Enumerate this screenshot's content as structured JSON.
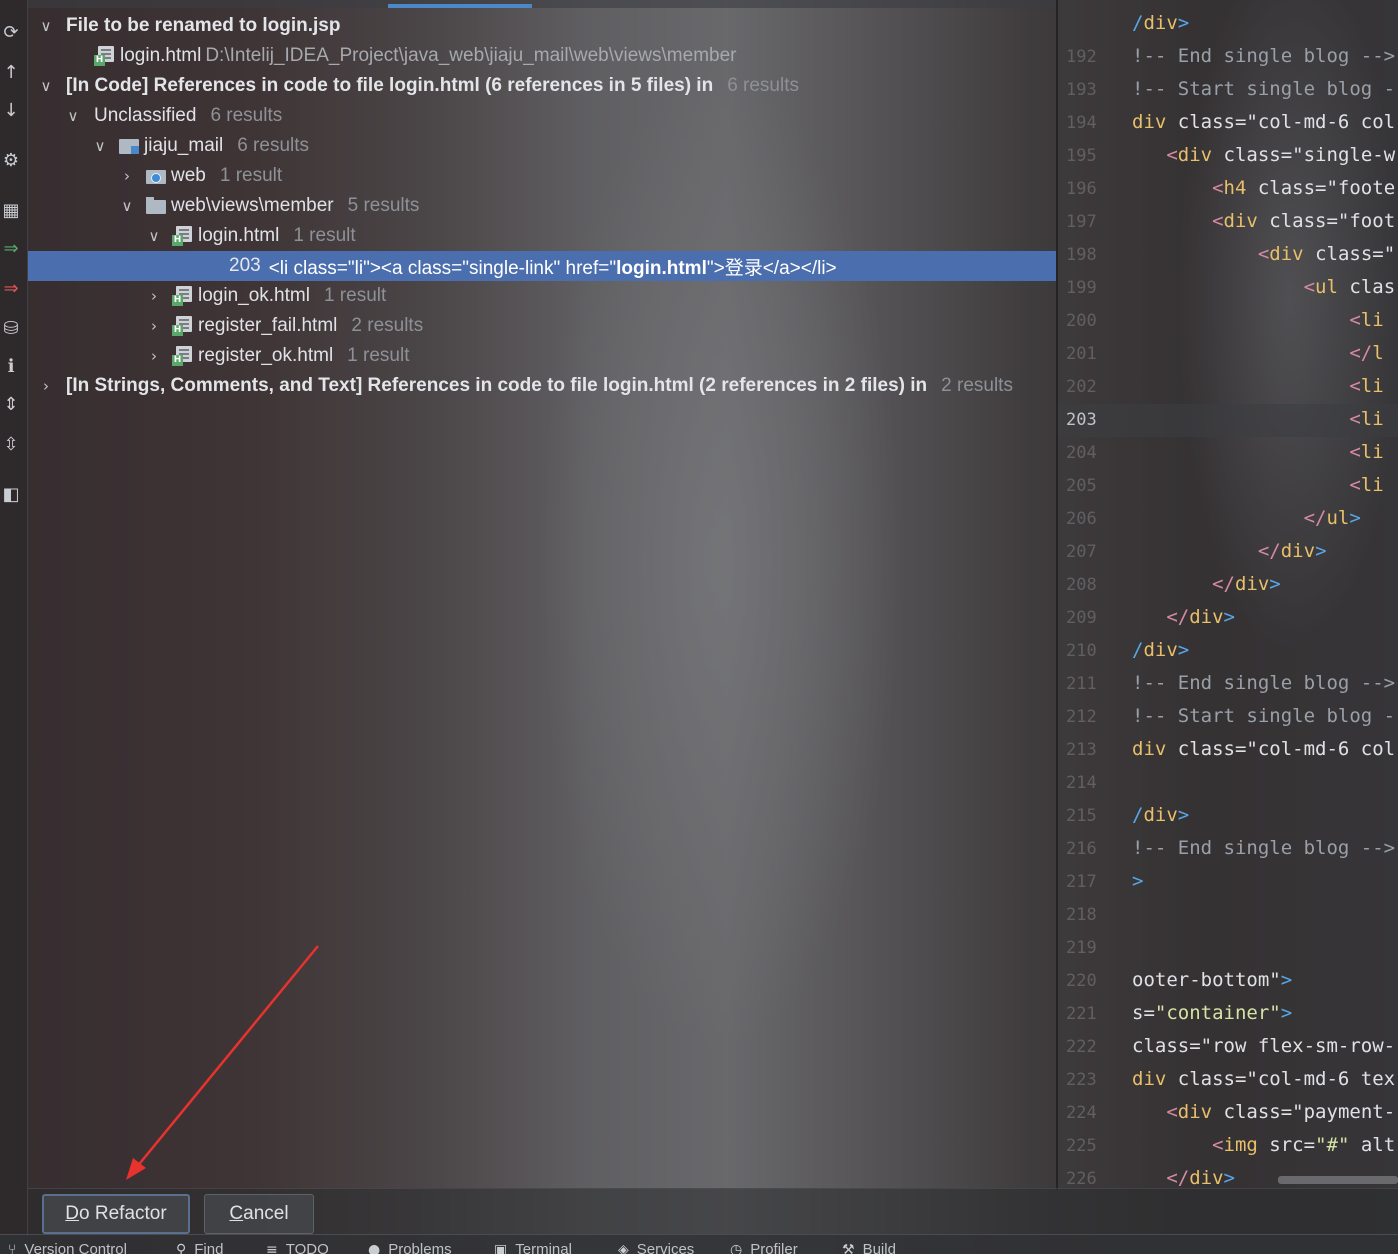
{
  "tree": {
    "rows": [
      {
        "level": 0,
        "expanded": true,
        "bold": true,
        "label": "File to be renamed to login.jsp"
      },
      {
        "level": 1,
        "icon": "html",
        "label": "login.html",
        "path": "D:\\Intelij_IDEA_Project\\java_web\\jiaju_mail\\web\\views\\member"
      },
      {
        "level": 0,
        "expanded": true,
        "bold": true,
        "label": "[In Code] References in code to file login.html (6 references in 5 files) in",
        "count": "6 results"
      },
      {
        "level": 1,
        "expanded": true,
        "label": "Unclassified",
        "count": "6 results"
      },
      {
        "level": 2,
        "expanded": true,
        "icon": "module",
        "label": "jiaju_mail",
        "count": "6 results"
      },
      {
        "level": 3,
        "expanded": false,
        "icon": "web",
        "label": "web",
        "count": "1 result"
      },
      {
        "level": 3,
        "expanded": true,
        "icon": "folder",
        "label": "web\\views\\member",
        "count": "5 results"
      },
      {
        "level": 4,
        "expanded": true,
        "icon": "html",
        "label": "login.html",
        "count": "1 result"
      },
      {
        "level": 5,
        "selected": true,
        "line": "203",
        "code_before": "<li class=\"li\"><a class=\"single-link\" href=\"",
        "code_bold": "login.html",
        "code_after": "\">登录</a></li>"
      },
      {
        "level": 4,
        "expanded": false,
        "icon": "html",
        "label": "login_ok.html",
        "count": "1 result"
      },
      {
        "level": 4,
        "expanded": false,
        "icon": "html",
        "label": "register_fail.html",
        "count": "2 results"
      },
      {
        "level": 4,
        "expanded": false,
        "icon": "html",
        "label": "register_ok.html",
        "count": "1 result"
      },
      {
        "level": 0,
        "expanded": false,
        "bold": true,
        "label": "[In Strings, Comments, and Text] References in code to file login.html (2 references in 2 files) in",
        "count": "2 results"
      }
    ]
  },
  "editor": {
    "current_line": "203",
    "lines": [
      {
        "num": "",
        "text": "/div>"
      },
      {
        "num": "192",
        "text": "!-- End single blog -->"
      },
      {
        "num": "193",
        "text": "!-- Start single blog -->"
      },
      {
        "num": "194",
        "text": "div class=\"col-md-6 col"
      },
      {
        "num": "195",
        "text": "   <div class=\"single-w"
      },
      {
        "num": "196",
        "text": "       <h4 class=\"foote"
      },
      {
        "num": "197",
        "text": "       <div class=\"foot"
      },
      {
        "num": "198",
        "text": "           <div class=\""
      },
      {
        "num": "199",
        "text": "               <ul clas"
      },
      {
        "num": "200",
        "text": "                   <li"
      },
      {
        "num": "201",
        "text": "                   </l"
      },
      {
        "num": "202",
        "text": "                   <li"
      },
      {
        "num": "203",
        "text": "                   <li"
      },
      {
        "num": "204",
        "text": "                   <li"
      },
      {
        "num": "205",
        "text": "                   <li"
      },
      {
        "num": "206",
        "text": "               </ul>"
      },
      {
        "num": "207",
        "text": "           </div>"
      },
      {
        "num": "208",
        "text": "       </div>"
      },
      {
        "num": "209",
        "text": "   </div>"
      },
      {
        "num": "210",
        "text": "/div>"
      },
      {
        "num": "211",
        "text": "!-- End single blog -->"
      },
      {
        "num": "212",
        "text": "!-- Start single blog -->"
      },
      {
        "num": "213",
        "text": "div class=\"col-md-6 col"
      },
      {
        "num": "214",
        "text": ""
      },
      {
        "num": "215",
        "text": "/div>"
      },
      {
        "num": "216",
        "text": "!-- End single blog -->"
      },
      {
        "num": "217",
        "text": ">"
      },
      {
        "num": "218",
        "text": ""
      },
      {
        "num": "219",
        "text": ""
      },
      {
        "num": "220",
        "text": "ooter-bottom\">"
      },
      {
        "num": "221",
        "text": "s=\"container\">"
      },
      {
        "num": "222",
        "text": "class=\"row flex-sm-row-"
      },
      {
        "num": "223",
        "text": "div class=\"col-md-6 tex"
      },
      {
        "num": "224",
        "text": "   <div class=\"payment-"
      },
      {
        "num": "225",
        "text": "       <img src=\"#\" alt"
      },
      {
        "num": "226",
        "text": "   </div>"
      }
    ]
  },
  "buttons": {
    "do_refactor_mnemonic": "D",
    "do_refactor_rest": "o Refactor",
    "cancel_mnemonic": "C",
    "cancel_rest": "ancel"
  },
  "status_tabs": [
    {
      "icon": "version-control-icon",
      "label": "Version Control"
    },
    {
      "icon": "find-icon",
      "label": "Find"
    },
    {
      "icon": "todo-icon",
      "label": "TODO"
    },
    {
      "icon": "problems-icon",
      "label": "Problems"
    },
    {
      "icon": "terminal-icon",
      "label": "Terminal"
    },
    {
      "icon": "services-icon",
      "label": "Services"
    },
    {
      "icon": "profiler-icon",
      "label": "Profiler"
    },
    {
      "icon": "build-icon",
      "label": "Build"
    }
  ],
  "colors": {
    "selection": "#4b6eaf",
    "annotation_arrow": "#e8322d",
    "html_badge": "#59a869"
  }
}
